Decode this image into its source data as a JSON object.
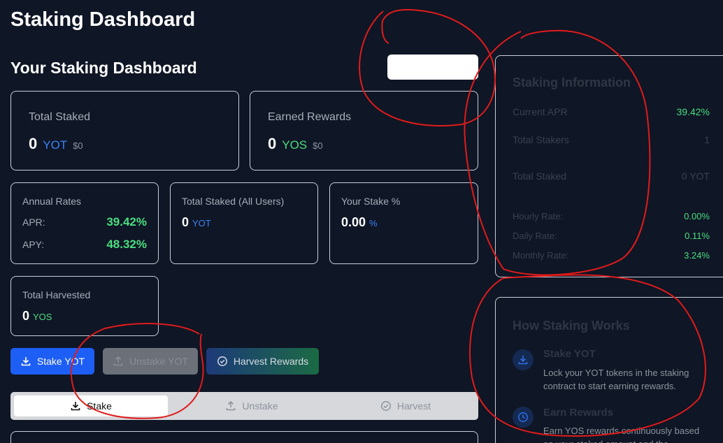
{
  "app_title": "Staking Dashboard",
  "section_title": "Your Staking Dashboard",
  "total_staked": {
    "label": "Total Staked",
    "value": "0",
    "unit": "YOT",
    "usd": "$0"
  },
  "earned_rewards": {
    "label": "Earned Rewards",
    "value": "0",
    "unit": "YOS",
    "usd": "$0"
  },
  "annual_rates": {
    "label": "Annual Rates",
    "apr_label": "APR:",
    "apr_value": "39.42%",
    "apy_label": "APY:",
    "apy_value": "48.32%"
  },
  "total_staked_all": {
    "label": "Total Staked (All Users)",
    "value": "0",
    "unit": "YOT"
  },
  "your_stake_pct": {
    "label": "Your Stake %",
    "value": "0.00",
    "unit": "%"
  },
  "total_harvested": {
    "label": "Total Harvested",
    "value": "0",
    "unit": "YOS"
  },
  "buttons": {
    "stake": "Stake YOT",
    "unstake": "Unstake YOT",
    "harvest": "Harvest Rewards"
  },
  "tabs": [
    {
      "label": "Stake"
    },
    {
      "label": "Unstake"
    },
    {
      "label": "Harvest"
    }
  ],
  "staking_info": {
    "title": "Staking Information",
    "rows": [
      {
        "label": "Current APR",
        "value": "39.42%"
      },
      {
        "label": "Total Stakers",
        "value": "1"
      },
      {
        "label": "Total Staked",
        "value": "0 YOT"
      },
      {
        "label": "Hourly Rate:",
        "value": "0.00%"
      },
      {
        "label": "Daily Rate:",
        "value": "0.11%"
      },
      {
        "label": "Monthly Rate:",
        "value": "3.24%"
      }
    ]
  },
  "how_it_works": {
    "title": "How Staking Works",
    "steps": [
      {
        "title": "Stake YOT",
        "desc": "Lock your YOT tokens in the staking contract to start earning rewards."
      },
      {
        "title": "Earn Rewards",
        "desc": "Earn YOS rewards continuously based on your staked amount and the"
      }
    ]
  },
  "colors": {
    "accent_blue": "#1d5ef5",
    "green": "#4ade80",
    "annotation_red": "#e01b1b"
  }
}
